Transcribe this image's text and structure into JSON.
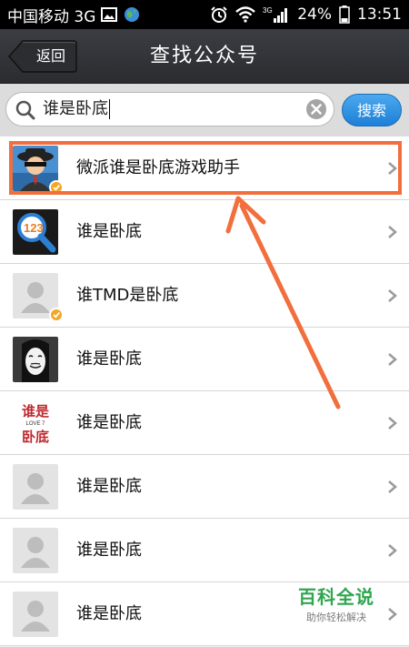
{
  "status_bar": {
    "carrier": "中国移动 3G",
    "network": "3G",
    "battery": "24%",
    "time": "13:51"
  },
  "header": {
    "back_label": "返回",
    "title": "查找公众号"
  },
  "search": {
    "query": "谁是卧底",
    "button_label": "搜索"
  },
  "results": [
    {
      "label": "微派谁是卧底游戏助手",
      "avatar": "spy-avatar",
      "verified": true,
      "highlighted": true
    },
    {
      "label": "谁是卧底",
      "avatar": "magnifier-123-avatar",
      "verified": false
    },
    {
      "label": "谁TMD是卧底",
      "avatar": "default-avatar",
      "verified": true
    },
    {
      "label": "谁是卧底",
      "avatar": "mask-avatar",
      "verified": false
    },
    {
      "label": "谁是卧底",
      "avatar": "text-logo-avatar",
      "verified": false,
      "avatar_text_top": "谁是",
      "avatar_text_mid": "LOVE 7",
      "avatar_text_bottom": "卧底"
    },
    {
      "label": "谁是卧底",
      "avatar": "default-avatar",
      "verified": false
    },
    {
      "label": "谁是卧底",
      "avatar": "default-avatar",
      "verified": false
    },
    {
      "label": "谁是卧底",
      "avatar": "default-avatar",
      "verified": false
    }
  ],
  "watermark": {
    "title": "百科全说",
    "subtitle": "助你轻松解决"
  },
  "colors": {
    "highlight": "#f26e3d",
    "search_button": "#1d7fd6",
    "verified_badge": "#f5a623",
    "watermark": "#2fa64f"
  }
}
